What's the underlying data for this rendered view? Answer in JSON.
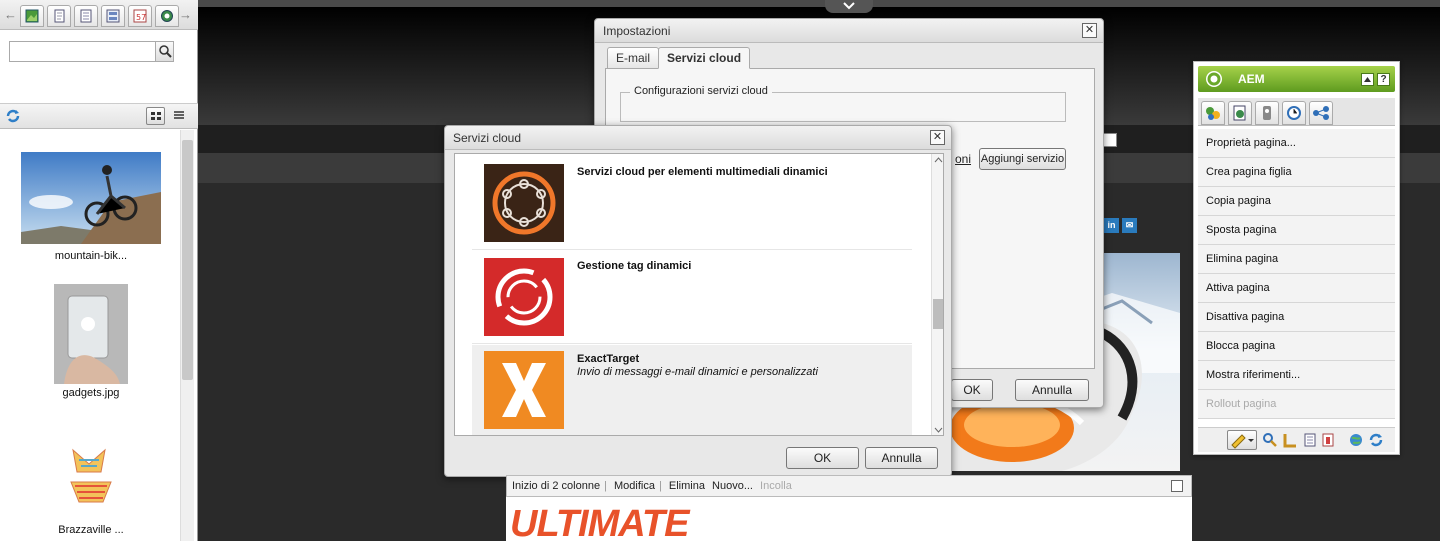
{
  "finder": {
    "search_placeholder": "",
    "assets": [
      {
        "label": "mountain-bik..."
      },
      {
        "label": "gadgets.jpg"
      },
      {
        "label": "Brazzaville ..."
      }
    ]
  },
  "settings_dialog": {
    "title": "Impostazioni",
    "tabs": [
      {
        "label": "E-mail"
      },
      {
        "label": "Servizi cloud"
      }
    ],
    "section_label": "Configurazioni servizi cloud",
    "partial_link": "oni",
    "add_service_button": "Aggiungi servizio",
    "ok_button": "OK",
    "cancel_button": "Annulla"
  },
  "cloud_dialog": {
    "title": "Servizi cloud",
    "services": [
      {
        "name": "Servizi cloud per elementi multimediali dinamici",
        "description": ""
      },
      {
        "name": "Gestione tag dinamici",
        "description": ""
      },
      {
        "name": "ExactTarget",
        "description": "Invio di messaggi e-mail dinamici e personalizzati"
      }
    ],
    "ok_button": "OK",
    "cancel_button": "Annulla"
  },
  "editbar": {
    "component": "Inizio di 2 colonne",
    "edit": "Modifica",
    "delete": "Elimina",
    "new": "Nuovo...",
    "paste": "Incolla"
  },
  "page": {
    "headline": "ULTIMATE",
    "social": [
      "in",
      "✉"
    ]
  },
  "sidekick": {
    "title": "AEM",
    "items": [
      {
        "label": "Proprietà pagina...",
        "enabled": true
      },
      {
        "label": "Crea pagina figlia",
        "enabled": true
      },
      {
        "label": "Copia pagina",
        "enabled": true
      },
      {
        "label": "Sposta pagina",
        "enabled": true
      },
      {
        "label": "Elimina pagina",
        "enabled": true
      },
      {
        "label": "Attiva pagina",
        "enabled": true
      },
      {
        "label": "Disattiva pagina",
        "enabled": true
      },
      {
        "label": "Blocca pagina",
        "enabled": true
      },
      {
        "label": "Mostra riferimenti...",
        "enabled": true
      },
      {
        "label": "Rollout pagina",
        "enabled": false
      }
    ]
  },
  "colors": {
    "accent_green": "#7ab62f",
    "headline_orange": "#e8522a",
    "exacttarget_orange": "#f08a22",
    "tag_red": "#d42a2a"
  }
}
